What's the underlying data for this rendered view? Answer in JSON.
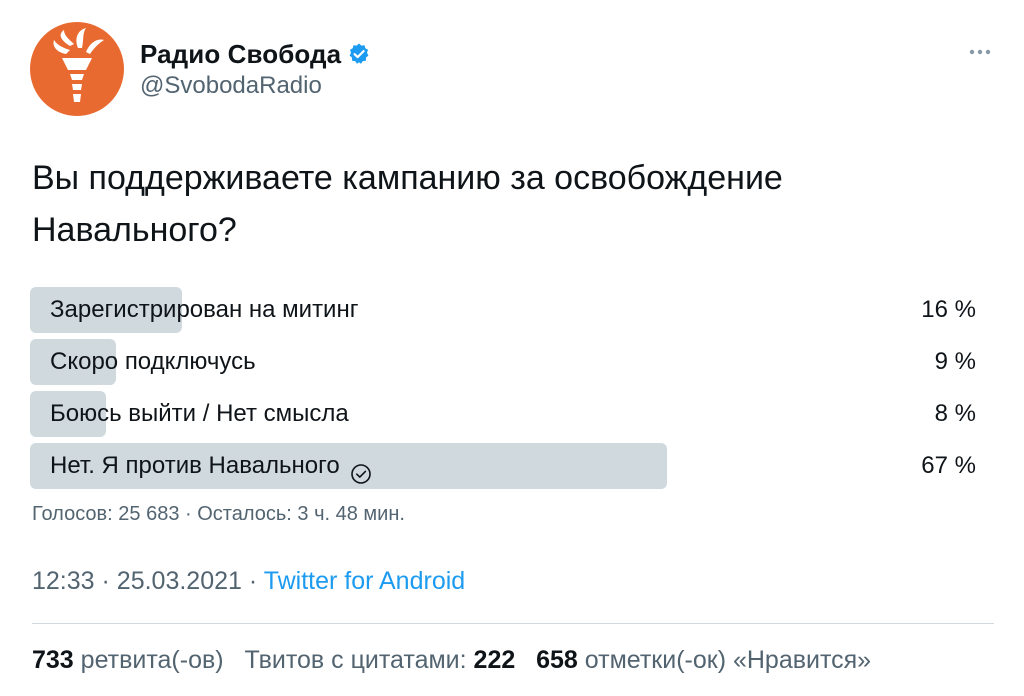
{
  "account": {
    "display_name": "Радио Свобода",
    "handle": "@SvobodaRadio",
    "verified": true,
    "avatar_icon": "torch-logo-icon",
    "avatar_color": "#e96a30"
  },
  "tweet": {
    "text_line1": "Вы поддерживаете кампанию за освобождение",
    "text_line2": "Навального?"
  },
  "poll": {
    "options": [
      {
        "label": "Зарегистрирован на митинг",
        "percent_label": "16 %",
        "percent": 16,
        "winner": false
      },
      {
        "label": "Скоро подключусь",
        "percent_label": "9 %",
        "percent": 9,
        "winner": false
      },
      {
        "label": "Боюсь выйти / Нет смысла",
        "percent_label": "8 %",
        "percent": 8,
        "winner": false
      },
      {
        "label": "Нет. Я против Навального",
        "percent_label": "67 %",
        "percent": 67,
        "winner": true
      }
    ],
    "meta": "Голосов: 25 683 · Осталось: 3 ч. 48 мин."
  },
  "timestamp": {
    "time": "12:33",
    "date": "25.03.2021",
    "source": "Twitter for Android"
  },
  "stats": {
    "retweets_count": "733",
    "retweets_label": "ретвита(-ов)",
    "quotes_label": "Твитов с цитатами:",
    "quotes_count": "222",
    "likes_count": "658",
    "likes_label": "отметки(-ок) «Нравится»"
  },
  "colors": {
    "accent": "#1d9bf0",
    "poll_bar": "#cfd9de",
    "secondary_text": "#536471"
  }
}
